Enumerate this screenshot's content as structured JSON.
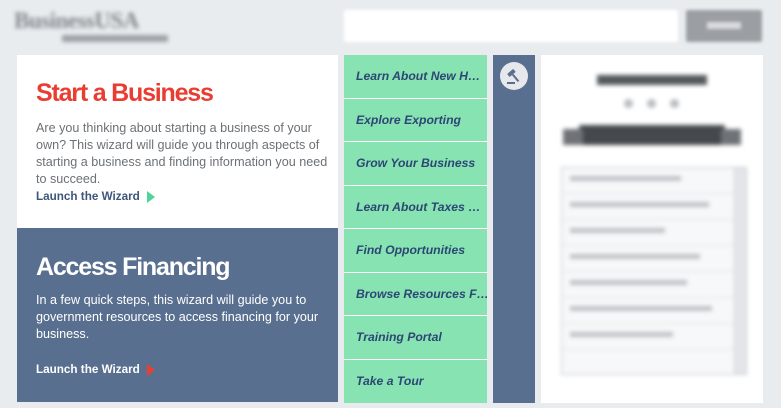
{
  "header": {
    "logo_text": "BusinessUSA"
  },
  "start_business": {
    "title": "Start a Business",
    "description": "Are you thinking about starting a business of your own? This wizard will guide you through aspects of starting a business and finding information you need to succeed.",
    "link": "Launch the Wizard"
  },
  "access_financing": {
    "title": "Access Financing",
    "description": "In a few quick steps, this wizard will guide you to government resources to access financing for your business.",
    "link": "Launch the Wizard"
  },
  "nav": {
    "items": [
      {
        "label": "Learn About New H…"
      },
      {
        "label": "Explore Exporting"
      },
      {
        "label": "Grow Your Business"
      },
      {
        "label": "Learn About Taxes …"
      },
      {
        "label": "Find Opportunities"
      },
      {
        "label": "Browse Resources F…"
      },
      {
        "label": "Training Portal"
      },
      {
        "label": "Take a Tour"
      }
    ]
  },
  "icons": {
    "start_arrow": "arrow-right-icon",
    "finance_arrow": "arrow-right-icon",
    "side_badge": "gavel-icon"
  },
  "colors": {
    "accent_red": "#ea3d32",
    "nav_green": "#88e3b3",
    "panel_blue": "#586f8f",
    "link_blue": "#3d5679",
    "nav_text": "#2c4774"
  }
}
